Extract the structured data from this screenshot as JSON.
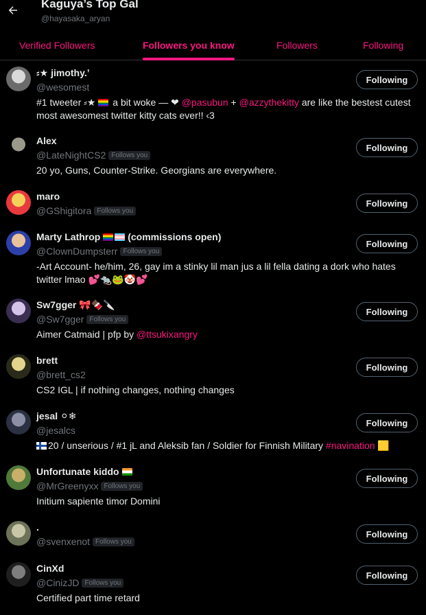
{
  "header": {
    "title": "Kaguya’s Top Gal",
    "handle": "@hayasaka_aryan",
    "back_icon": "arrow-left-icon"
  },
  "tabs": [
    {
      "label": "Verified Followers",
      "active": false
    },
    {
      "label": "Followers you know",
      "active": true
    },
    {
      "label": "Followers",
      "active": false
    },
    {
      "label": "Following",
      "active": false
    }
  ],
  "follows_you_label": "Follows you",
  "users": [
    {
      "name": "⸗★ jimothy.ʼ",
      "handle": "@wesomest",
      "follows_you": false,
      "button": "Following",
      "bio_parts": [
        "#1 tweeter ⸗★ ",
        "[rainbow]",
        " a bit woke — ",
        "❤",
        " ",
        {
          "link": "@pasubun"
        },
        " + ",
        {
          "link": "@azzythekitty"
        },
        " are like the bestest cutest most awesomest twitter kitty cats ever!! ‹3"
      ],
      "avatar_colors": [
        "#6b6b6b",
        "#d9d9d9"
      ]
    },
    {
      "name": "Alex",
      "handle": "@LateNightCS2",
      "follows_you": true,
      "button": "Following",
      "bio": "20 yo, Guns, Counter-Strike. Georgians are everywhere.",
      "avatar_colors": [
        "#000000",
        "#9a9a8a"
      ]
    },
    {
      "name": "maro",
      "handle": "@GShigitora",
      "follows_you": true,
      "button": "Following",
      "bio": "",
      "avatar_colors": [
        "#e8393e",
        "#f2d05a"
      ]
    },
    {
      "name": "Marty Lathrop",
      "name_suffix": " (commissions open)",
      "handle": "@ClownDumpsterr",
      "follows_you": true,
      "button": "Following",
      "bio": "-Art Account- he/him, 26, gay im a stinky lil man jus a lil fella dating a dork who hates twitter lmao",
      "bio_tail": " 💕🐀🐸🤡💕",
      "avatar_colors": [
        "#2d3fa8",
        "#e9c29b"
      ]
    },
    {
      "name": "Sw7gger",
      "name_suffix": " 🎀🍫🔪",
      "handle": "@Sw7gger",
      "follows_you": true,
      "button": "Following",
      "bio_parts": [
        "Aimer Catmaid | pfp by ",
        {
          "link": "@ttsukixangry"
        }
      ],
      "avatar_colors": [
        "#3a2e52",
        "#d6c3e8"
      ]
    },
    {
      "name": "brett",
      "handle": "@brett_cs2",
      "follows_you": false,
      "button": "Following",
      "bio": "CS2 IGL | if nothing changes, nothing changes",
      "avatar_colors": [
        "#2a2a1a",
        "#e2d48a"
      ]
    },
    {
      "name": "jesal",
      "name_suffix": " ⚪❄",
      "handle": "@jesalcs",
      "follows_you": false,
      "button": "Following",
      "bio_parts": [
        "[finland]",
        "20 / unserious / #1 jL and Aleksib fan / Soldier for Finnish Military ",
        {
          "link": "#navination"
        },
        " 🟨"
      ],
      "avatar_colors": [
        "#2b3142",
        "#8c8fa6"
      ]
    },
    {
      "name": "Unfortunate kiddo",
      "name_suffix": "[india]",
      "handle": "@MrGreenyxx",
      "follows_you": true,
      "button": "Following",
      "bio": "Initium sapiente timor Domini",
      "avatar_colors": [
        "#4f7a3a",
        "#c9b06a"
      ]
    },
    {
      "name": ".",
      "handle": "@svenxenot",
      "follows_you": true,
      "button": "Following",
      "bio": "",
      "avatar_colors": [
        "#6d7358",
        "#c9c6a8"
      ]
    },
    {
      "name": "CinXd",
      "handle": "@CinizJD",
      "follows_you": true,
      "button": "Following",
      "bio": "Certified part time retard",
      "avatar_colors": [
        "#1f1f1f",
        "#7e7e7e"
      ]
    }
  ]
}
